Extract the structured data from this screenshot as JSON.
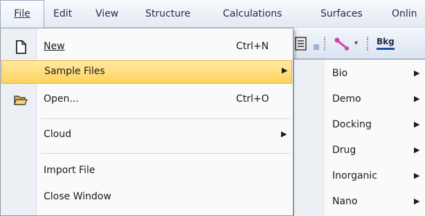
{
  "menubar": {
    "items": [
      {
        "label": "File",
        "name": "menu-file"
      },
      {
        "label": "Edit",
        "name": "menu-edit"
      },
      {
        "label": "View",
        "name": "menu-view"
      },
      {
        "label": "Structure",
        "name": "menu-structure"
      },
      {
        "label": "Calculations",
        "name": "menu-calculations"
      },
      {
        "label": "Surfaces",
        "name": "menu-surfaces"
      },
      {
        "label": "Onlin",
        "name": "menu-online"
      }
    ]
  },
  "toolbar": {
    "text_button": "Bkg"
  },
  "file_menu": {
    "new": {
      "label": "New",
      "shortcut": "Ctrl+N"
    },
    "sample_files": {
      "label": "Sample Files"
    },
    "open": {
      "label": "Open...",
      "shortcut": "Ctrl+O"
    },
    "cloud": {
      "label": "Cloud"
    },
    "import_file": {
      "label": "Import File"
    },
    "close_window": {
      "label": "Close Window"
    }
  },
  "sample_files_submenu": {
    "items": [
      {
        "label": "Bio"
      },
      {
        "label": "Demo"
      },
      {
        "label": "Docking"
      },
      {
        "label": "Drug"
      },
      {
        "label": "Inorganic"
      },
      {
        "label": "Nano"
      }
    ]
  },
  "colors": {
    "highlight": "#ffd25c",
    "menubar": "#e3e9f3",
    "gutter": "#eceff4"
  }
}
